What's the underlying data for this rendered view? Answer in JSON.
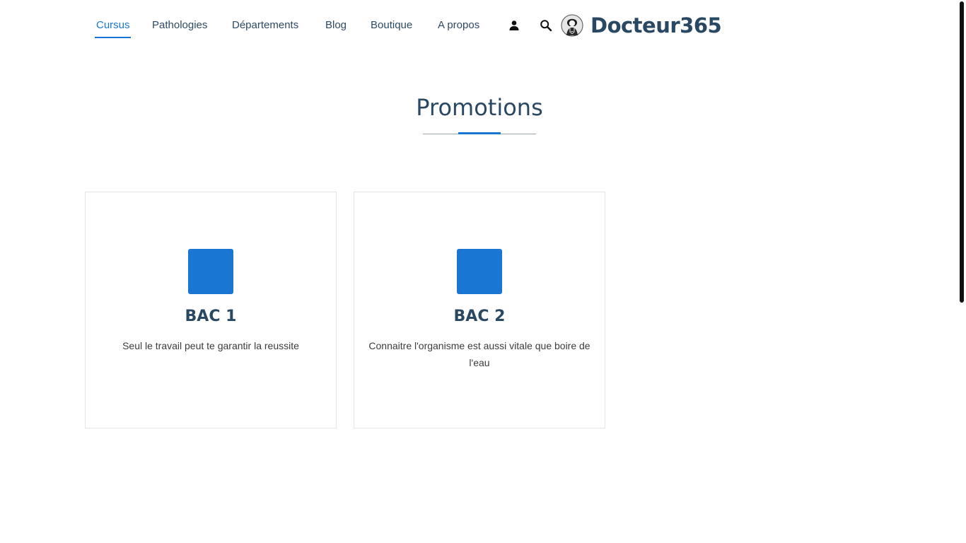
{
  "nav": {
    "items": [
      {
        "label": "Cursus",
        "active": true
      },
      {
        "label": "Pathologies",
        "active": false
      },
      {
        "label": "Départements",
        "active": false
      },
      {
        "label": "Blog",
        "active": false
      },
      {
        "label": "Boutique",
        "active": false
      },
      {
        "label": "A propos",
        "active": false
      }
    ],
    "icons": [
      "user-icon",
      "search-icon"
    ],
    "brand": "Docteur365"
  },
  "section": {
    "title": "Promotions"
  },
  "cards": [
    {
      "title": "BAC 1",
      "text": "Seul le travail peut te garantir la reussite"
    },
    {
      "title": "BAC 2",
      "text": "Connaitre l'organisme est aussi vitale que boire de l'eau"
    }
  ],
  "colors": {
    "accent": "#1976d2",
    "heading": "#2b4863",
    "nav_text": "#2e4a63"
  }
}
